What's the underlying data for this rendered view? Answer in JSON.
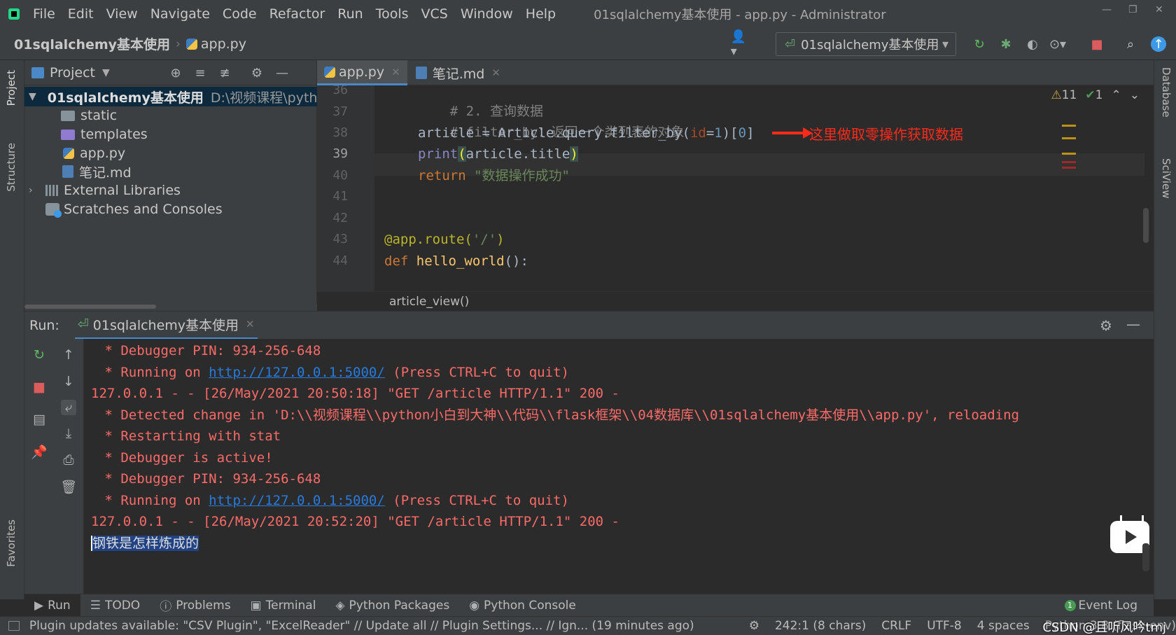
{
  "menubar": {
    "items": [
      "File",
      "Edit",
      "View",
      "Navigate",
      "Code",
      "Refactor",
      "Run",
      "Tools",
      "VCS",
      "Window",
      "Help"
    ],
    "window_title": "01sqlalchemy基本使用 - app.py - Administrator"
  },
  "navbar": {
    "project": "01sqlalchemy基本使用",
    "file": "app.py",
    "run_config": "01sqlalchemy基本使用"
  },
  "left_strip": {
    "project": "Project",
    "structure": "Structure",
    "favorites": "Favorites"
  },
  "right_strip": {
    "database": "Database",
    "sciview": "SciView"
  },
  "project_panel": {
    "title": "Project",
    "root": "01sqlalchemy基本使用",
    "root_path": "D:\\视频课程\\python",
    "items": [
      "static",
      "templates",
      "app.py",
      "笔记.md"
    ],
    "external": "External Libraries",
    "scratches": "Scratches and Consoles"
  },
  "editor": {
    "tabs": [
      "app.py",
      "笔记.md"
    ],
    "line_numbers": [
      "36",
      "37",
      "38",
      "39",
      "40",
      "41",
      "42",
      "43",
      "44"
    ],
    "lines": {
      "l36": "# 2. 查询数据",
      "l37": "# filter_by：返回一个类列表的对象",
      "l38_a": "article = Article.query.filter_by(",
      "l38_b": "id",
      "l38_c": "=",
      "l38_d": "1",
      "l38_e": ")[",
      "l38_f": "0",
      "l38_g": "]",
      "l39_a": "print",
      "l39_b": "(",
      "l39_c": "article.title",
      "l39_d": ")",
      "l40_a": "return ",
      "l40_b": "\"数据操作成功\"",
      "l43_a": "@app.route(",
      "l43_b": "'/'",
      "l43_c": ")",
      "l44_a": "def ",
      "l44_b": "hello_world",
      "l44_c": "():"
    },
    "annotation": "这里做取零操作获取数据",
    "inspection_warnings": "11",
    "inspection_ok": "1",
    "breadcrumb": "article_view()"
  },
  "run_panel": {
    "label": "Run:",
    "tab": "01sqlalchemy基本使用",
    "console": {
      "c1": " * Debugger PIN: 934-256-648",
      "c2_a": " * Running on ",
      "c2_link": "http://127.0.0.1:5000/",
      "c2_b": " (Press CTRL+C to quit)",
      "c3": "127.0.0.1 - - [26/May/2021 20:50:18] \"GET /article HTTP/1.1\" 200 -",
      "c4": " * Detected change in 'D:\\\\视频课程\\\\python小白到大神\\\\代码\\\\flask框架\\\\04数据库\\\\01sqlalchemy基本使用\\\\app.py', reloading",
      "c5": " * Restarting with stat",
      "c6": " * Debugger is active!",
      "c7": " * Debugger PIN: 934-256-648",
      "c8_a": " * Running on ",
      "c8_link": "http://127.0.0.1:5000/",
      "c8_b": " (Press CTRL+C to quit)",
      "c9": "127.0.0.1 - - [26/May/2021 20:52:20] \"GET /article HTTP/1.1\" 200 -",
      "c10": "钢铁是怎样炼成的"
    }
  },
  "tool_tabs": [
    "Run",
    "TODO",
    "Problems",
    "Terminal",
    "Python Packages",
    "Python Console"
  ],
  "event_log": "Event Log",
  "status": {
    "message": "Plugin updates available: \"CSV Plugin\", \"ExcelReader\" // Update all // Plugin Settings... // Ign... (19 minutes ago)",
    "position": "242:1 (8 chars)",
    "line_sep": "CRLF",
    "encoding": "UTF-8",
    "indent": "4 spaces",
    "interpreter": "Python 3.8 (flask-env)"
  },
  "watermark": "CSDN @且听风吟tmj"
}
